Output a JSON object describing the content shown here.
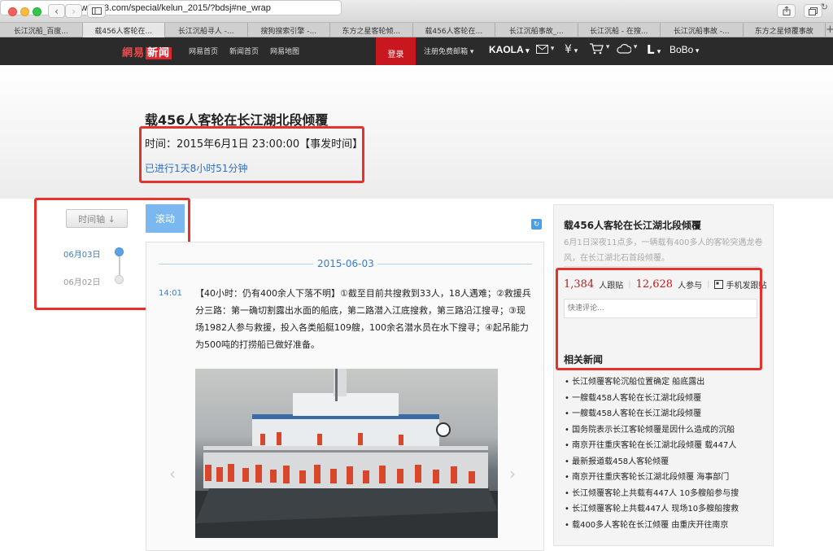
{
  "browser": {
    "url": "news.163.com/special/kelun_2015/?bdsj#ne_wrap",
    "tabs": [
      "长江沉船_百度...",
      "载456人客轮在...",
      "长江沉船寻人 -...",
      "搜狗搜索引擎 -...",
      "东方之星客轮倾...",
      "载456人客轮在...",
      "长江沉船事故_...",
      "长江沉船 - 在搜...",
      "长江沉船事故 -...",
      "东方之星倾覆事故"
    ],
    "active_tab": 1,
    "new_tab_label": "+"
  },
  "topnav": {
    "logo_a": "網易",
    "logo_b": "新闻",
    "links": [
      "网易首页",
      "新闻首页",
      "网易地图"
    ],
    "login": "登录",
    "register": "注册免费邮箱",
    "kaola": "KAOLA",
    "bobo": "BoBo",
    "l_label": "L"
  },
  "article": {
    "title": "载456人客轮在长江湖北段倾覆",
    "event_time": "时间：2015年6月1日 23:00:00【事发时间】",
    "elapsed": "已进行1天8小时51分钟"
  },
  "timeline": {
    "sort_button": "时间轴 ↓",
    "scroll_button": "滚动",
    "dates": [
      "06月03日",
      "06月02日"
    ]
  },
  "feed": {
    "day": "2015-06-03",
    "time": "14:01",
    "text": "【40小时：仍有400余人下落不明】①截至目前共搜救到33人，18人遇难；②救援兵分三路：第一确切割露出水面的船底，第二路潜入江底搜救，第三路沿江搜寻；③现场1982人参与救援，投入各类船艇109艘，100余名潜水员在水下搜寻；④起吊能力为500吨的打捞船已做好准备。"
  },
  "sidebar": {
    "title": "载456人客轮在长江湖北段倾覆",
    "summary": "6月1日深夜11点多，一辆载有400多人的客轮突遇龙卷风，在长江湖北石首段倾覆。",
    "posts_count": "1,384",
    "posts_label": "人跟贴",
    "participants_count": "12,628",
    "participants_label": "人参与",
    "mobile_post": "手机发跟贴",
    "comment_placeholder": "快速评论...",
    "related_title": "相关新闻",
    "related": [
      "• 长江倾覆客轮沉船位置确定 船底露出",
      "• 一艘载458人客轮在长江湖北段倾覆",
      "• 一艘载458人客轮在长江湖北段倾覆",
      "• 国务院表示长江客轮倾覆是因什么造成的沉船",
      "• 南京开往重庆客轮在长江湖北段倾覆 载447人",
      "• 最新报道载458人客轮倾覆",
      "• 南京开往重庆客轮长江湖北段倾覆 海事部门",
      "• 长江倾覆客轮上共载有447人 10多艘船参与搜",
      "• 长江倾覆客轮上共载447人 现场10多艘船搜救",
      "• 载400多人客轮在长江倾覆 由重庆开往南京"
    ]
  },
  "colors": {
    "accent_blue": "#3a7dc9",
    "brand_red": "#c8171e",
    "highlight_red": "#e5322d"
  }
}
